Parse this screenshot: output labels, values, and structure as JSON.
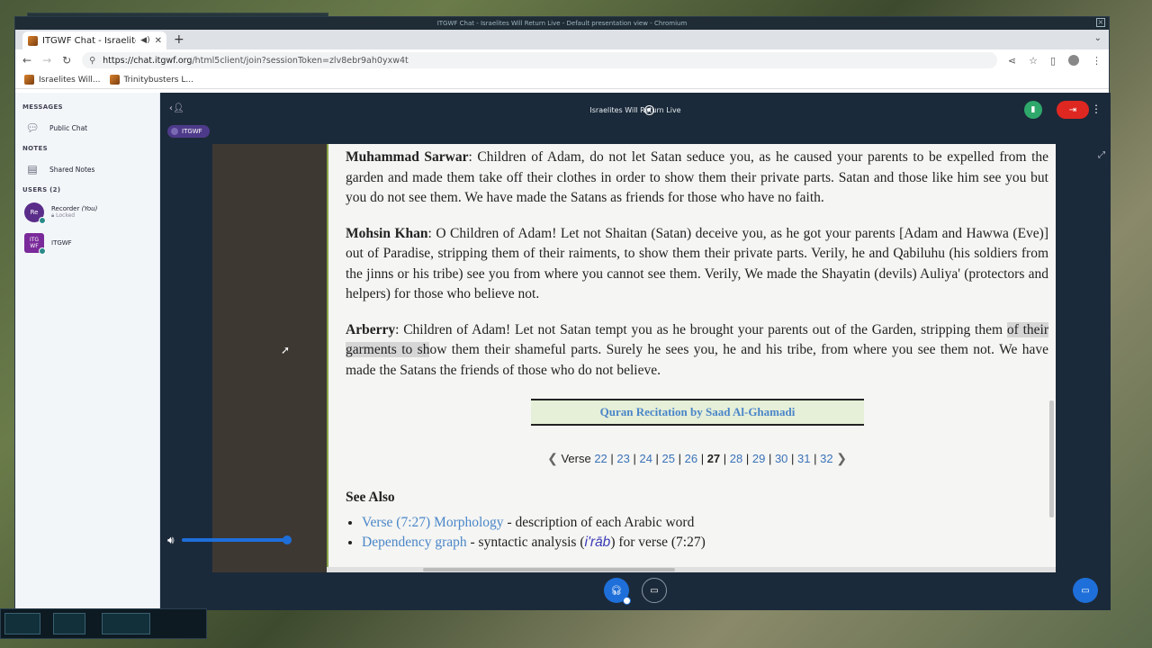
{
  "window": {
    "title": "ITGWF Chat - Israelites Will Return Live - Default presentation view - Chromium"
  },
  "browser": {
    "tab_title": "ITGWF Chat - Israelites",
    "url_host": "https://chat.itgwf.org",
    "url_path": "/html5client/join?sessionToken=zlv8ebr9ah0yxw4t",
    "bookmarks": [
      "Israelites Will...",
      "Trinitybusters L..."
    ]
  },
  "sidebar": {
    "messages_title": "MESSAGES",
    "public_chat": "Public Chat",
    "notes_title": "NOTES",
    "shared_notes": "Shared Notes",
    "users_title": "USERS (2)",
    "users": [
      {
        "initials": "Re",
        "name": "Recorder",
        "you": "(You)",
        "status": "Locked"
      },
      {
        "initials": "ITG WF",
        "name": "ITGWF"
      }
    ]
  },
  "main": {
    "meeting_title": "Israelites Will Return Live",
    "presenter": "ITGWF"
  },
  "content": {
    "p1_name": "Muhammad Sarwar",
    "p1_text": ": Children of Adam, do not let Satan seduce you, as he caused your parents to be expelled from the garden and made them take off their clothes in order to show them their private parts. Satan and those like him see you but you do not see them. We have made the Satans as friends for those who have no faith.",
    "p2_name": "Mohsin Khan",
    "p2_text": ": O Children of Adam! Let not Shaitan (Satan) deceive you, as he got your parents [Adam and Hawwa (Eve)] out of Paradise, stripping them of their raiments, to show them their private parts. Verily, he and Qabiluhu (his soldiers from the jinns or his tribe) see you from where you cannot see them. Verily, We made the Shayatin (devils) Auliya' (protectors and helpers) for those who believe not.",
    "p3_name": "Arberry",
    "p3_text_a": ": Children of Adam! Let not Satan tempt you as he brought your parents out of the Garden, stripping them ",
    "p3_highlight": "of their garments to sh",
    "p3_text_b": "ow them their shameful parts. Surely he sees you, he and his tribe, from where you see them not. We have made the Satans the friends of those who do not believe.",
    "recitation": "Quran Recitation by Saad Al-Ghamadi",
    "verse_label": "Verse",
    "verses": [
      "22",
      "23",
      "24",
      "25",
      "26",
      "27",
      "28",
      "29",
      "30",
      "31",
      "32"
    ],
    "current_verse": "27",
    "see_also": "See Also",
    "link1": "Verse (7:27) Morphology",
    "link1_desc": " - description of each Arabic word",
    "link2": "Dependency graph",
    "link2_desc_a": " - syntactic analysis (",
    "link2_irab": "i'rāb",
    "link2_desc_b": ") for verse (7:27)"
  },
  "colors": {
    "accent": "#1e6fd9",
    "leave": "#df2721",
    "connection": "#2ea86b",
    "link": "#4a86c8"
  }
}
